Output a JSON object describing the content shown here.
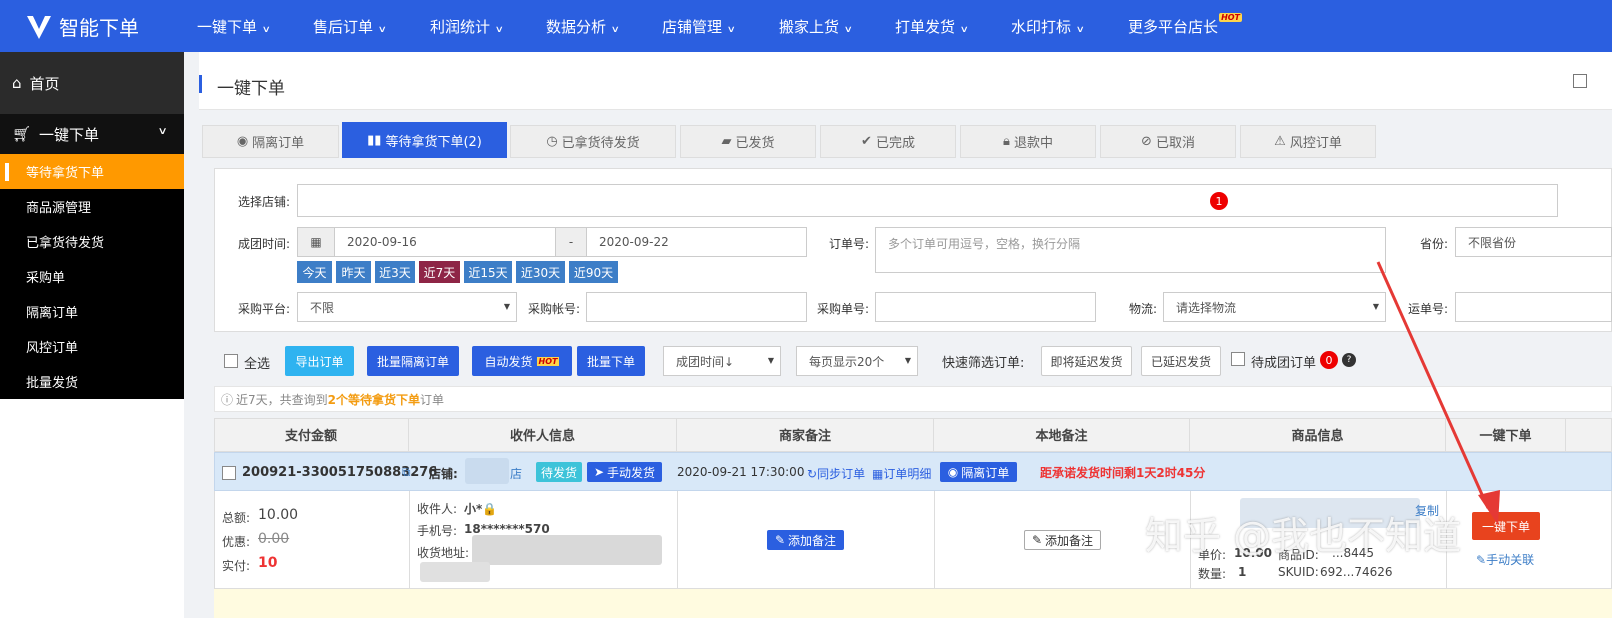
{
  "nav": {
    "brand": "智能下单",
    "items": [
      "一键下单",
      "售后订单",
      "利润统计",
      "数据分析",
      "店铺管理",
      "搬家上货",
      "打单发货",
      "水印打标",
      "更多平台店长"
    ],
    "hot": "HOT"
  },
  "sidebar": {
    "home": "首页",
    "group": "一键下单",
    "items": [
      "等待拿货下单",
      "商品源管理",
      "已拿货待发货",
      "采购单",
      "隔离订单",
      "风控订单",
      "批量发货"
    ]
  },
  "page": {
    "title": "一键下单"
  },
  "tabs": [
    "隔离订单",
    "等待拿货下单(2)",
    "已拿货待发货",
    "已发货",
    "已完成",
    "退款中",
    "已取消",
    "风控订单"
  ],
  "filter": {
    "shop_label": "选择店铺:",
    "badge": "1",
    "time_label": "成团时间:",
    "date_from": "2020-09-16",
    "date_sep": "-",
    "date_to": "2020-09-22",
    "order_label": "订单号:",
    "order_placeholder": "多个订单可用逗号，空格，换行分隔",
    "province_label": "省份:",
    "province_value": "不限省份",
    "quick": [
      "今天",
      "昨天",
      "近3天",
      "近7天",
      "近15天",
      "近30天",
      "近90天"
    ],
    "platform_label": "采购平台:",
    "platform_value": "不限",
    "account_label": "采购帐号:",
    "purchase_no_label": "采购单号:",
    "logistics_label": "物流:",
    "logistics_value": "请选择物流",
    "tracking_label": "运单号:"
  },
  "toolbar": {
    "select_all": "全选",
    "export": "导出订单",
    "batch_isolate": "批量隔离订单",
    "auto_ship": "自动发货",
    "batch_order": "批量下单",
    "sort": "成团时间↓",
    "per_page": "每页显示20个",
    "quick_filter": "快速筛选订单:",
    "soon_delay": "即将延迟发货",
    "delayed": "已延迟发货",
    "pending_group": "待成团订单",
    "pending_count": "0",
    "help": "?"
  },
  "info": {
    "prefix": "近7天，共查询到",
    "highlight": "2个等待拿货下单",
    "suffix": "订单"
  },
  "table": {
    "headers": [
      "支付金额",
      "收件人信息",
      "商家备注",
      "本地备注",
      "商品信息",
      "一键下单"
    ],
    "order": {
      "id": "200921-330051750883276",
      "shop_label": "店铺:",
      "shop_suffix": "店",
      "status": "待发货",
      "manual_ship": "手动发货",
      "time": "2020-09-21 17:30:00",
      "sync": "同步订单",
      "detail": "订单明细",
      "isolate": "隔离订单",
      "deadline": "距承诺发货时间剩1天2时45分"
    },
    "row": {
      "total_label": "总额:",
      "total": "10.00",
      "discount_label": "优惠:",
      "discount": "0.00",
      "paid_label": "实付:",
      "paid": "10",
      "receiver_label": "收件人:",
      "receiver": "小*🔒",
      "phone_label": "手机号:",
      "phone": "18*******570",
      "address_label": "收货地址:",
      "add_note": "添加备注",
      "add_local_note": "添加备注",
      "goods_link": "复制",
      "price_label": "单价:",
      "price": "10.00",
      "goods_label": "商品ID:",
      "goods_id": "...8445",
      "qty_label": "数量:",
      "qty": "1",
      "sku_label": "SKUID:",
      "sku": "692...74626",
      "one_click": "一键下单",
      "manual_link": "手动关联"
    }
  },
  "watermark": "知乎 @我也不知道"
}
